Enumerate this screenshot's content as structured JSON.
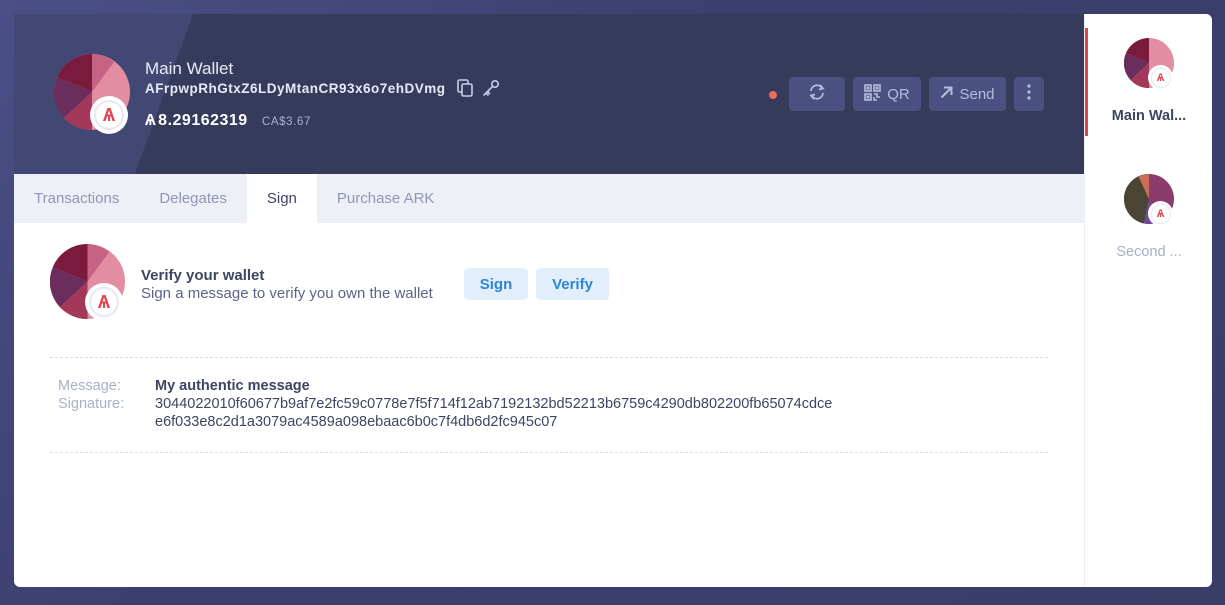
{
  "wallet": {
    "name": "Main Wallet",
    "address": "AFrpwpRhGtxZ6LDyMtanCR93x6o7ehDVmg",
    "balance": "8.29162319",
    "balance_symbol": "Ѧ",
    "fiat": "CA$3.67",
    "icons": {
      "copy": "copy-icon",
      "key": "key-icon"
    },
    "status_color": "#f06b5b"
  },
  "header_buttons": {
    "refresh_icon": "refresh-icon",
    "qr_label": "QR",
    "send_label": "Send",
    "more_icon": "more-vertical-icon"
  },
  "tabs": [
    {
      "label": "Transactions",
      "active": false
    },
    {
      "label": "Delegates",
      "active": false
    },
    {
      "label": "Sign",
      "active": true
    },
    {
      "label": "Purchase ARK",
      "active": false
    }
  ],
  "sign": {
    "title": "Verify your wallet",
    "subtitle": "Sign a message to verify you own the wallet",
    "sign_button": "Sign",
    "verify_button": "Verify",
    "message_label": "Message:",
    "message_value": "My authentic message",
    "signature_label": "Signature:",
    "signature_line1": "3044022010f60677b9af7e2fc59c0778e7f5f714f12ab7192132bd52213b6759c4290db802200fb65074cdce",
    "signature_line2": "e6f033e8c2d1a3079ac4589a098ebaac6b0c7f4db6d2fc945c07"
  },
  "sidebar": {
    "wallets": [
      {
        "label": "Main Wal...",
        "active": true
      },
      {
        "label": "Second ...",
        "active": false
      }
    ]
  },
  "colors": {
    "accent": "#e04550",
    "link": "#2c87d4",
    "header_bg": "#373b5b",
    "tab_bg": "#eef0f8"
  }
}
